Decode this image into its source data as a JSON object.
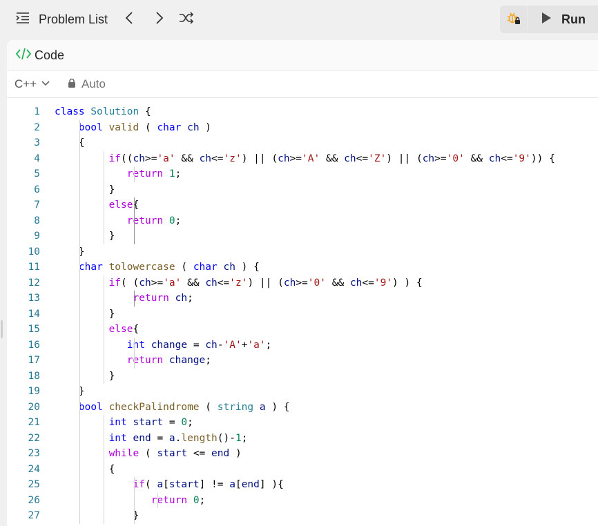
{
  "topbar": {
    "problem_list_label": "Problem List",
    "run_label": "Run",
    "icons": [
      "list-icon",
      "chevron-left-icon",
      "chevron-right-icon",
      "shuffle-icon",
      "debug-locked-icon",
      "play-icon"
    ]
  },
  "panel": {
    "title": "Code",
    "language": "C++",
    "mode": "Auto"
  },
  "colors": {
    "accent_code_icon": "#2db55d",
    "debug_icon": "#f5a623",
    "keyword": "#0000ff",
    "control": "#af00db",
    "type": "#267f99",
    "function": "#795e26",
    "variable": "#001080",
    "string": "#a31515",
    "number": "#098658",
    "line_number": "#237893"
  },
  "code": {
    "line_numbers": [
      "1",
      "2",
      "3",
      "4",
      "5",
      "6",
      "7",
      "8",
      "9",
      "10",
      "11",
      "12",
      "13",
      "14",
      "15",
      "16",
      "17",
      "18",
      "19",
      "20",
      "21",
      "22",
      "23",
      "24",
      "25",
      "26",
      "27"
    ],
    "lines": [
      "class Solution {",
      "    bool valid ( char ch )",
      "    {",
      "         if((ch>='a' && ch<='z') || (ch>='A' && ch<='Z') || (ch>='0' && ch<='9')) {",
      "            return 1;",
      "         }",
      "         else{",
      "            return 0;",
      "         }",
      "    }",
      "    char tolowercase ( char ch ) {",
      "         if( (ch>='a' && ch<='z') || (ch>='0' && ch<='9') ) {",
      "             return ch;",
      "         }",
      "         else{",
      "            int change = ch-'A'+'a';",
      "            return change;",
      "         }",
      "    }",
      "    bool checkPalindrome ( string a ) {",
      "         int start = 0;",
      "         int end = a.length()-1;",
      "         while ( start <= end )",
      "         {",
      "             if( a[start] != a[end] ){",
      "                return 0;",
      "             }"
    ]
  }
}
